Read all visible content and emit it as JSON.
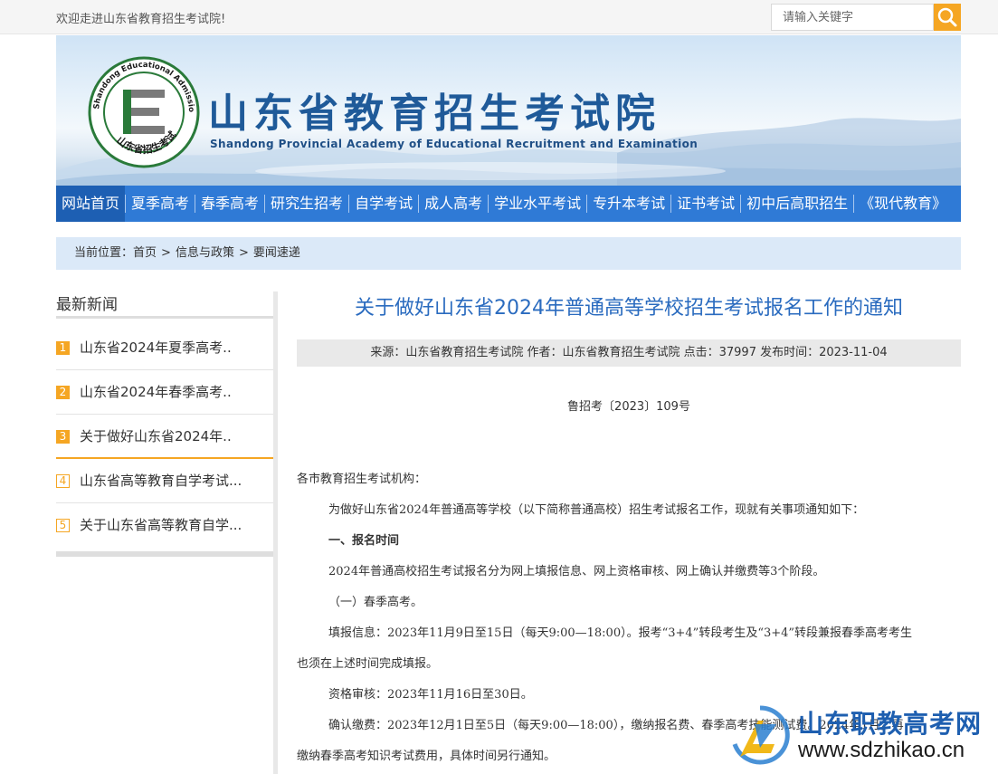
{
  "topbar": {
    "welcome": "欢迎走进山东省教育招生考试院!",
    "search_placeholder": "请输入关键字"
  },
  "header": {
    "title": "山东省教育招生考试院",
    "subtitle": "Shandong Provincial Academy of Educational Recruitment and Examination",
    "seal_text_top": "Shandong Educational Admission & Examinations",
    "seal_text_bottom": "山东省招生考试"
  },
  "nav": {
    "items": [
      {
        "label": "网站首页"
      },
      {
        "label": "夏季高考"
      },
      {
        "label": "春季高考"
      },
      {
        "label": "研究生招考"
      },
      {
        "label": "自学考试"
      },
      {
        "label": "成人高考"
      },
      {
        "label": "学业水平考试"
      },
      {
        "label": "专升本考试"
      },
      {
        "label": "证书考试"
      },
      {
        "label": "初中后高职招生"
      },
      {
        "label": "《现代教育》"
      }
    ]
  },
  "breadcrumb": {
    "prefix": "当前位置：",
    "items": [
      "首页",
      "信息与政策",
      "要闻速递"
    ],
    "sep": ">"
  },
  "sidebar": {
    "title": "最新新闻",
    "items": [
      {
        "num": "1",
        "label": "山东省2024年夏季高考.."
      },
      {
        "num": "2",
        "label": "山东省2024年春季高考.."
      },
      {
        "num": "3",
        "label": "关于做好山东省2024年.."
      },
      {
        "num": "4",
        "label": "山东省高等教育自学考试..."
      },
      {
        "num": "5",
        "label": "关于山东省高等教育自学..."
      }
    ]
  },
  "article": {
    "title": "关于做好山东省2024年普通高等学校招生考试报名工作的通知",
    "meta": "来源：山东省教育招生考试院 作者：山东省教育招生考试院 点击：37997 发布时间：2023-11-04",
    "doc_number": "鲁招考〔2023〕109号",
    "paragraphs": [
      "各市教育招生考试机构：",
      "为做好山东省2024年普通高等学校（以下简称普通高校）招生考试报名工作，现就有关事项通知如下：",
      "一、报名时间",
      "2024年普通高校招生考试报名分为网上填报信息、网上资格审核、网上确认并缴费等3个阶段。",
      "（一）春季高考。",
      "填报信息：2023年11月9日至15日（每天9:00—18:00）。报考“3+4”转段考生及“3+4”转段兼报春季高考考生",
      "也须在上述时间完成填报。",
      "资格审核：2023年11月16日至30日。",
      "确认缴费：2023年12月1日至5日（每天9:00—18:00），缴纳报名费、春季高考技能测试费。2024年1月，再",
      "缴纳春季高考知识考试费用，具体时间另行通知。"
    ]
  },
  "watermark": {
    "title": "山东职教高考网",
    "url": "www.sdzhikao.cn"
  },
  "colors": {
    "nav_bg": "#2f7ad6",
    "nav_active": "#1d5fb3",
    "accent_orange": "#f5a623",
    "title_blue": "#2a6bbf",
    "crumb_bg": "#dbe9f8"
  }
}
